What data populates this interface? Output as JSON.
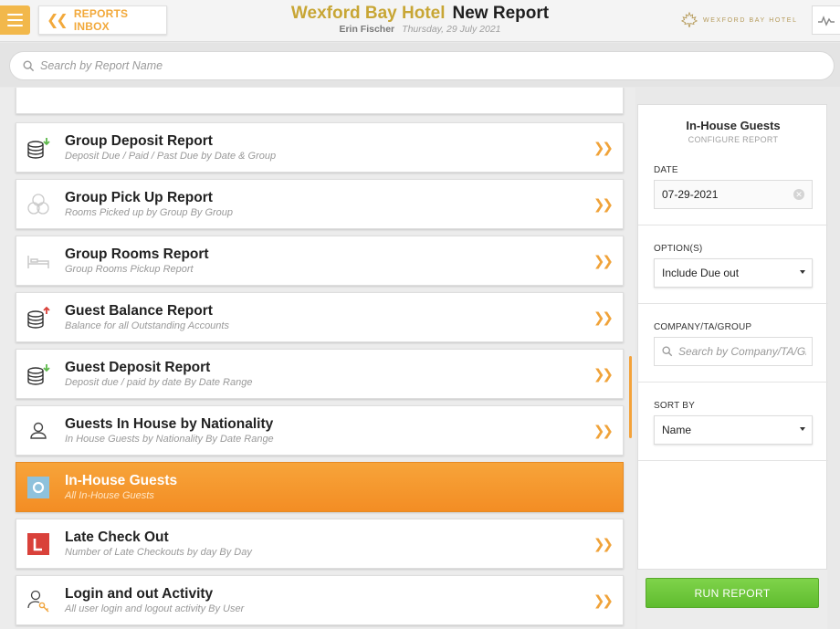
{
  "header": {
    "back_label": "REPORTS INBOX",
    "hotel_name": "Wexford Bay Hotel",
    "page_title": "New Report",
    "user_name": "Erin Fischer",
    "date_text": "Thursday, 29 July 2021",
    "brand_name": "WEXFORD BAY HOTEL"
  },
  "search": {
    "placeholder": "Search by Report Name"
  },
  "reports": [
    {
      "title": "Group Deposit Report",
      "description": "Deposit Due / Paid / Past Due by Date & Group",
      "icon": "coins-down-icon"
    },
    {
      "title": "Group Pick Up Report",
      "description": "Rooms Picked up by Group By Group",
      "icon": "circles-icon"
    },
    {
      "title": "Group Rooms Report",
      "description": "Group Rooms Pickup Report",
      "icon": "bed-icon"
    },
    {
      "title": "Guest Balance Report",
      "description": "Balance for all Outstanding Accounts",
      "icon": "coins-up-icon"
    },
    {
      "title": "Guest Deposit Report",
      "description": "Deposit due / paid by date By Date Range",
      "icon": "coins-down-icon"
    },
    {
      "title": "Guests In House by Nationality",
      "description": "In House Guests by Nationality By Date Range",
      "icon": "person-icon"
    },
    {
      "title": "In-House Guests",
      "description": "All In-House Guests",
      "icon": "in-house-icon",
      "selected": true
    },
    {
      "title": "Late Check Out",
      "description": "Number of Late Checkouts by day By Day",
      "icon": "late-checkout-icon"
    },
    {
      "title": "Login and out Activity",
      "description": "All user login and logout activity By User",
      "icon": "user-key-icon"
    }
  ],
  "config": {
    "title": "In-House Guests",
    "subtitle": "CONFIGURE REPORT",
    "date_label": "DATE",
    "date_value": "07-29-2021",
    "options_label": "OPTION(S)",
    "options_value": "Include Due out",
    "company_label": "COMPANY/TA/GROUP",
    "company_placeholder": "Search by Company/TA/Group",
    "sort_label": "SORT BY",
    "sort_value": "Name",
    "run_label": "RUN REPORT"
  },
  "colors": {
    "accent_orange": "#f4a23a",
    "hotel_gold": "#c8a635",
    "run_green": "#6cc53a",
    "late_red": "#d9413a",
    "inhouse_blue": "#8fc2dc"
  }
}
